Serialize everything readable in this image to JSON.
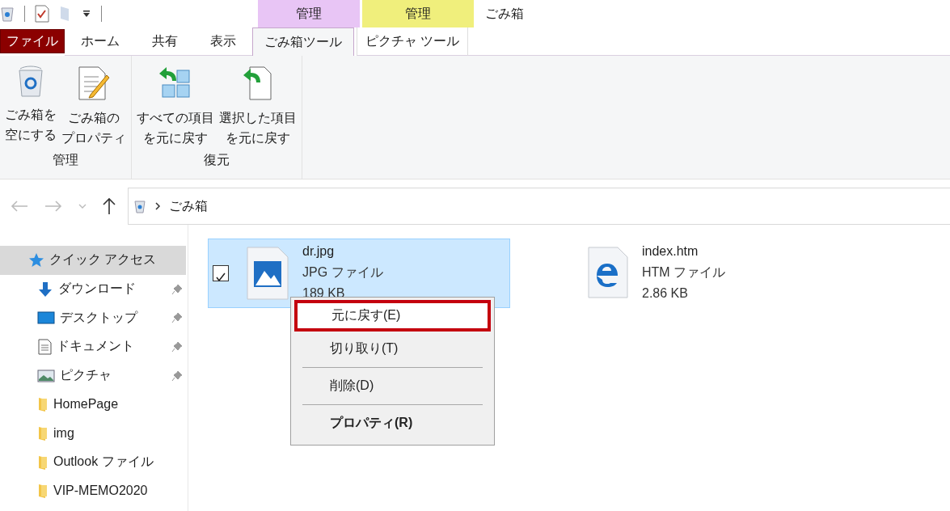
{
  "window": {
    "title": "ごみ箱"
  },
  "context_tab_groups": [
    {
      "label": "管理",
      "color": "#e8c5f5"
    },
    {
      "label": "管理",
      "color": "#f0ef7c"
    }
  ],
  "tabs": [
    {
      "label": "ファイル",
      "kind": "file",
      "selected": false
    },
    {
      "label": "ホーム",
      "kind": "plain",
      "selected": false
    },
    {
      "label": "共有",
      "kind": "plain",
      "selected": false
    },
    {
      "label": "表示",
      "kind": "plain",
      "selected": false
    },
    {
      "label": "ごみ箱ツール",
      "kind": "context",
      "selected": true
    },
    {
      "label": "ピクチャ ツール",
      "kind": "context",
      "selected": false
    }
  ],
  "ribbon_groups": [
    {
      "label": "管理",
      "buttons": [
        {
          "lines": [
            "ごみ箱を",
            "空にする"
          ],
          "kind": "bin"
        },
        {
          "lines": [
            "ごみ箱の",
            "プロパティ"
          ],
          "kind": "properties"
        }
      ]
    },
    {
      "label": "復元",
      "buttons": [
        {
          "lines": [
            "すべての項目",
            "を元に戻す"
          ],
          "kind": "restore-all"
        },
        {
          "lines": [
            "選択した項目",
            "を元に戻す"
          ],
          "kind": "restore-selected"
        }
      ]
    }
  ],
  "address": {
    "path": "ごみ箱"
  },
  "nav_items": [
    {
      "label": "クイック アクセス",
      "kind": "star",
      "pinned": false,
      "selected": true
    },
    {
      "label": "ダウンロード",
      "kind": "download",
      "pinned": true,
      "selected": false
    },
    {
      "label": "デスクトップ",
      "kind": "desktop",
      "pinned": true,
      "selected": false
    },
    {
      "label": "ドキュメント",
      "kind": "document",
      "pinned": true,
      "selected": false
    },
    {
      "label": "ピクチャ",
      "kind": "pictures",
      "pinned": true,
      "selected": false
    },
    {
      "label": "HomePage",
      "kind": "folder",
      "pinned": false,
      "selected": false
    },
    {
      "label": "img",
      "kind": "folder",
      "pinned": false,
      "selected": false
    },
    {
      "label": "Outlook ファイル",
      "kind": "folder",
      "pinned": false,
      "selected": false
    },
    {
      "label": "VIP-MEMO2020",
      "kind": "folder",
      "pinned": false,
      "selected": false
    }
  ],
  "files": [
    {
      "name": "dr.jpg",
      "type": "JPG ファイル",
      "size": "189 KB",
      "kind": "image",
      "selected": true,
      "checked": true
    },
    {
      "name": "index.htm",
      "type": "HTM ファイル",
      "size": "2.86 KB",
      "kind": "web",
      "selected": false,
      "checked": false
    }
  ],
  "context_menu": {
    "groups": [
      [
        {
          "label": "元に戻す(E)",
          "highlighted": true,
          "default": false
        },
        {
          "label": "切り取り(T)",
          "highlighted": false,
          "default": false
        }
      ],
      [
        {
          "label": "削除(D)",
          "highlighted": false,
          "default": false
        }
      ],
      [
        {
          "label": "プロパティ(R)",
          "highlighted": false,
          "default": true
        }
      ]
    ]
  }
}
